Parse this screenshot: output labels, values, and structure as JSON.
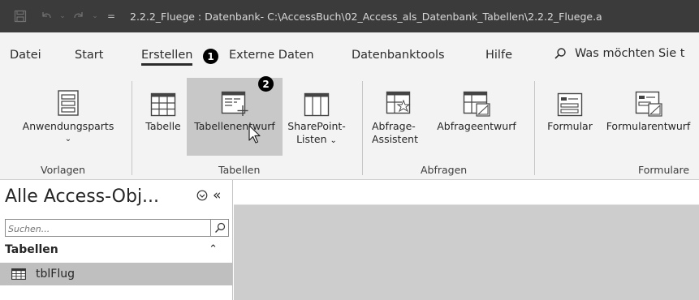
{
  "titlebar": {
    "title": "2.2.2_Fluege : Datenbank- C:\\AccessBuch\\02_Access_als_Datenbank_Tabellen\\2.2.2_Fluege.a"
  },
  "menu": {
    "tabs": [
      "Datei",
      "Start",
      "Erstellen",
      "Externe Daten",
      "Datenbanktools",
      "Hilfe"
    ],
    "active_tab": "Erstellen",
    "badge1": "1",
    "badge2": "2",
    "search_placeholder": "Was möchten Sie t"
  },
  "ribbon": {
    "groups": {
      "vorlagen": "Vorlagen",
      "tabellen": "Tabellen",
      "abfragen": "Abfragen",
      "formulare": "Formulare"
    },
    "buttons": {
      "anwendungsparts": "Anwendungsparts",
      "tabelle": "Tabelle",
      "tabellenentwurf": "Tabellenentwurf",
      "sharepoint_line1": "SharePoint-",
      "sharepoint_line2": "Listen",
      "abfrage_line1": "Abfrage-",
      "abfrage_line2": "Assistent",
      "abfrageentwurf": "Abfrageentwurf",
      "formular": "Formular",
      "formularentwurf": "Formularentwurf"
    }
  },
  "nav": {
    "title": "Alle Access-Obj...",
    "search_placeholder": "Suchen...",
    "category": "Tabellen",
    "items": [
      "tblFlug"
    ]
  }
}
